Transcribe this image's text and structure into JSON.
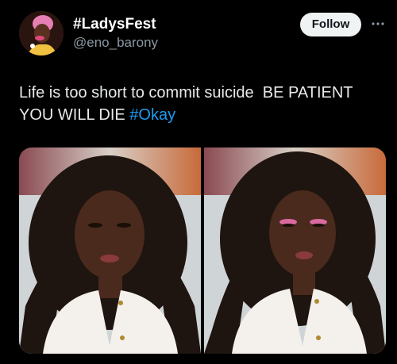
{
  "tweet": {
    "display_name": "#LadysFest",
    "handle": "@eno_barony",
    "follow_label": "Follow",
    "more_icon": "more-horizontal-icon",
    "text_main": "Life is too short to commit suicide  BE PATIENT YOU WILL DIE ",
    "hashtag": "#Okay"
  },
  "colors": {
    "background": "#000000",
    "text": "#e7e9ea",
    "secondary_text": "#8b98a5",
    "link": "#1d9bf0",
    "follow_bg": "#eff3f4",
    "follow_text": "#0f1419"
  },
  "media": {
    "count": 2,
    "photos": [
      {
        "description_icon": "photo-woman-curly-hair-white-shirt"
      },
      {
        "description_icon": "photo-woman-curly-hair-pink-eyeshadow"
      }
    ]
  }
}
